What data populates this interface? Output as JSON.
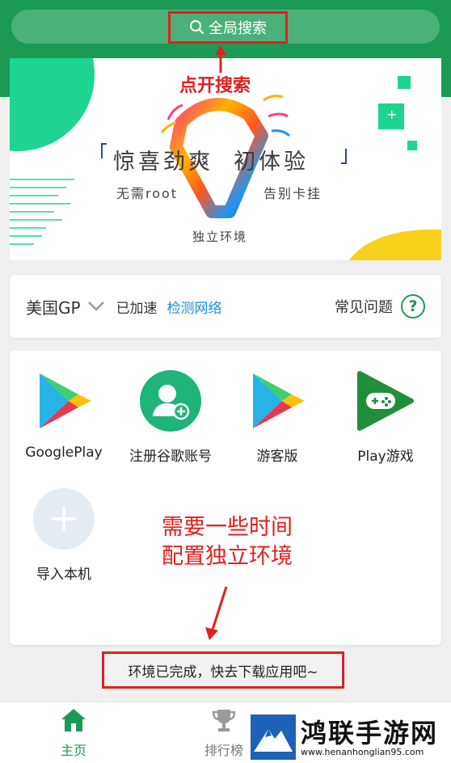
{
  "search": {
    "label": "全局搜索",
    "annotation": "点开搜索"
  },
  "banner": {
    "headline": "惊喜劲爽  初体验",
    "left_text": "无需root",
    "right_text": "告别卡挂",
    "bottom_text": "独立环境",
    "plus": "+"
  },
  "status": {
    "region": "美国GP",
    "accelerated": "已加速",
    "detect_link": "检测网络",
    "faq": "常见问题",
    "help_glyph": "?"
  },
  "apps": [
    {
      "label": "GooglePlay",
      "icon": "play-store-icon"
    },
    {
      "label": "注册谷歌账号",
      "icon": "register-account-icon"
    },
    {
      "label": "游客版",
      "icon": "play-store-icon"
    },
    {
      "label": "Play游戏",
      "icon": "play-games-icon"
    },
    {
      "label": "导入本机",
      "icon": "plus-icon"
    }
  ],
  "annotation_wait_line1": "需要一些时间",
  "annotation_wait_line2": "配置独立环境",
  "toast": "环境已完成，快去下载应用吧~",
  "nav": {
    "home": "主页",
    "rank": "排行榜"
  },
  "watermark": {
    "title": "鸿联手游网",
    "url": "www.henanhonglian95.com"
  },
  "colors": {
    "brand_green": "#1a9a55",
    "annotation_red": "#e02020",
    "link_blue": "#1a8fd8"
  }
}
